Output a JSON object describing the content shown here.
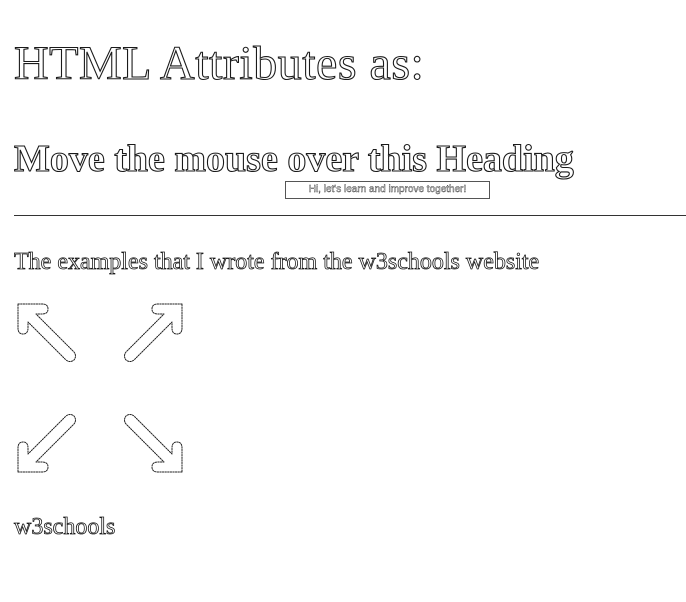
{
  "page": {
    "title": "HTML Attributes as:",
    "hover_heading": "Move the mouse over this Heading",
    "tooltip": "Hi, let's learn and improve together!",
    "intro": "The examples that I wrote from the w3schools website",
    "footer_link": "w3schools"
  },
  "images": [
    {
      "name": "arrow-up-left-icon"
    },
    {
      "name": "arrow-up-right-icon"
    },
    {
      "name": "arrow-down-left-icon"
    },
    {
      "name": "arrow-down-right-icon"
    }
  ],
  "colors": {
    "background": "#ffffff",
    "outline": "#1a1a1a"
  }
}
